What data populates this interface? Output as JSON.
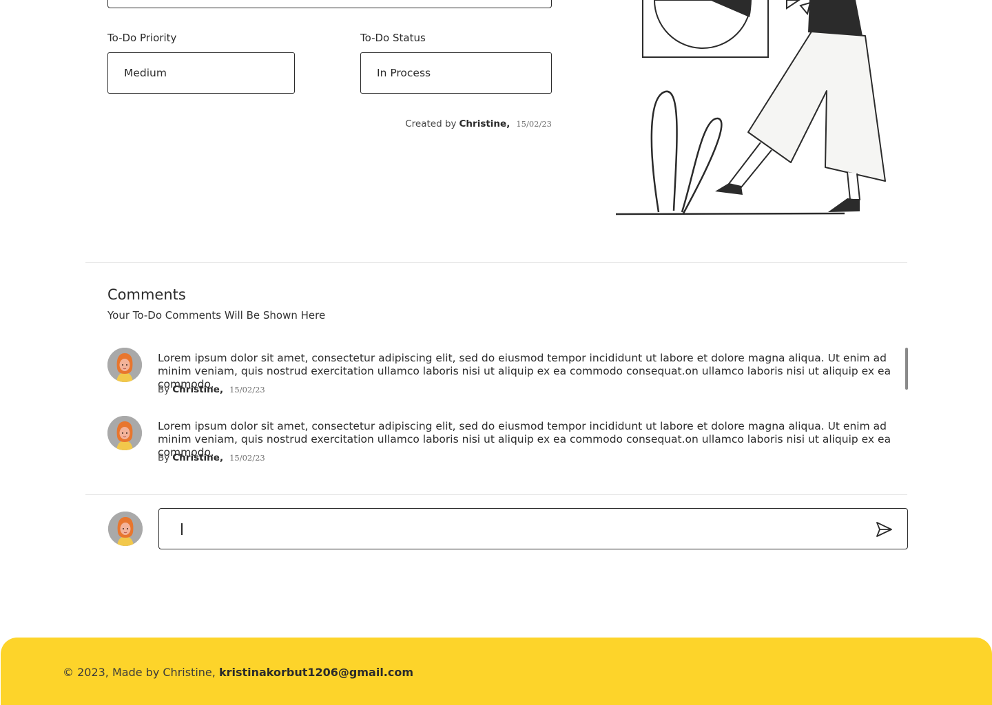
{
  "form": {
    "priority": {
      "label": "To-Do Priority",
      "value": "Medium"
    },
    "status": {
      "label": "To-Do Status",
      "value": "In Process"
    },
    "created": {
      "prefix": "Created by",
      "author": "Christine,",
      "date": "15/02/23"
    }
  },
  "comments": {
    "title": "Comments",
    "subtitle": "Your To-Do Comments Will Be Shown Here",
    "items": [
      {
        "text": "Lorem ipsum dolor sit amet, consectetur adipiscing elit, sed do eiusmod tempor incididunt ut labore et dolore magna aliqua. Ut enim ad minim veniam, quis nostrud exercitation ullamco laboris nisi ut aliquip ex ea commodo consequat.on ullamco laboris nisi ut aliquip ex ea commodo.",
        "by": "By",
        "author": "Christine,",
        "date": "15/02/23"
      },
      {
        "text": "Lorem ipsum dolor sit amet, consectetur adipiscing elit, sed do eiusmod tempor incididunt ut labore et dolore magna aliqua. Ut enim ad minim veniam, quis nostrud exercitation ullamco laboris nisi ut aliquip ex ea commodo consequat.on ullamco laboris nisi ut aliquip ex ea commodo.",
        "by": "By",
        "author": "Christine,",
        "date": "15/02/23"
      }
    ],
    "input": {
      "value": "",
      "send_icon": "send-icon"
    }
  },
  "footer": {
    "text": "© 2023, Made by Christine,",
    "email": "kristinakorbut1206@gmail.com"
  },
  "colors": {
    "footer_bg": "#fdd42a",
    "text": "#2b2b2b",
    "border": "#2b2b2b"
  }
}
